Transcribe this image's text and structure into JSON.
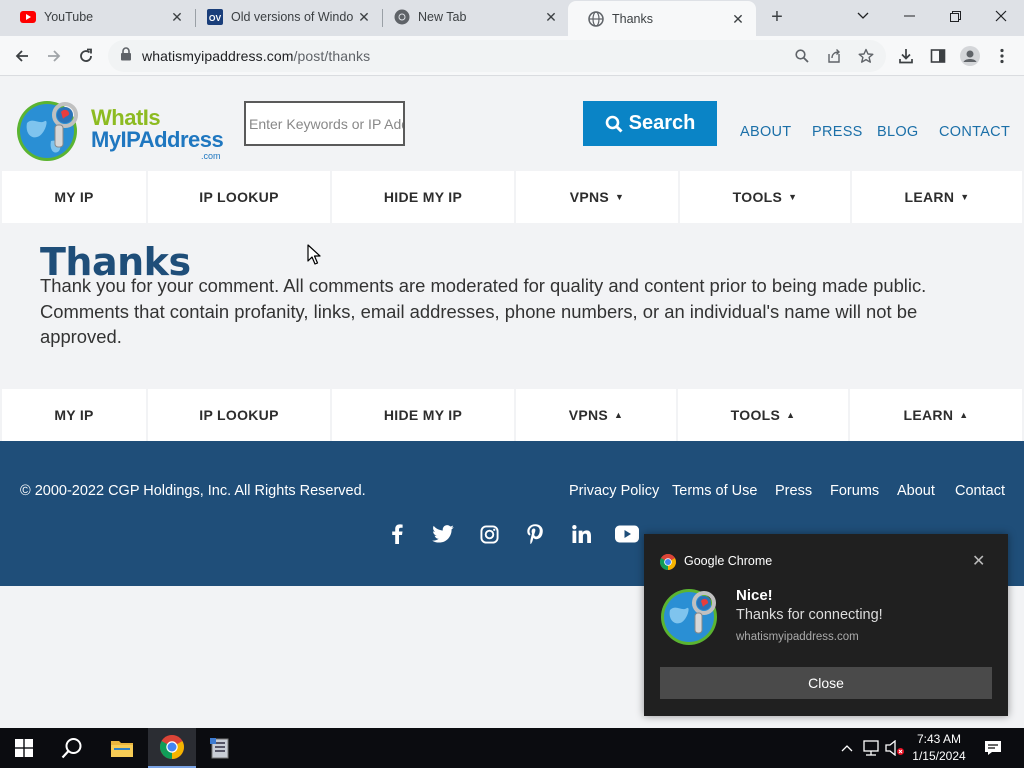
{
  "browser": {
    "tabs": [
      {
        "label": "YouTube",
        "icon": "youtube-icon",
        "active": false
      },
      {
        "label": "Old versions of Windo",
        "icon": "oldversion-icon",
        "active": false
      },
      {
        "label": "New Tab",
        "icon": "chrome-icon",
        "active": false
      },
      {
        "label": "Thanks",
        "icon": "globe-icon",
        "active": true
      }
    ],
    "url_host": "whatismyipaddress.com",
    "url_path": "/post/thanks"
  },
  "site": {
    "logo": {
      "line1": "WhatIs",
      "line2": "MyIPAddress",
      "line3": ".com"
    },
    "search_placeholder": "Enter Keywords or IP Address",
    "search_button": "Search",
    "top_nav": [
      "ABOUT",
      "PRESS",
      "BLOG",
      "CONTACT"
    ],
    "menu_top": [
      "MY IP",
      "IP LOOKUP",
      "HIDE MY IP",
      "VPNS",
      "TOOLS",
      "LEARN"
    ],
    "menu_top_carets": [
      "",
      "",
      "",
      "▼",
      "▼",
      "▼"
    ],
    "menu_bottom": [
      "MY IP",
      "IP LOOKUP",
      "HIDE MY IP",
      "VPNS",
      "TOOLS",
      "LEARN"
    ],
    "menu_bottom_carets": [
      "",
      "",
      "",
      "▲",
      "▲",
      "▲"
    ],
    "title": "Thanks",
    "body": "Thank you for your comment. All comments are moderated for quality and content prior to being made public. Comments that contain profanity, links, email addresses, phone numbers, or an individual's name will not be approved.",
    "footer": {
      "copyright": "© 2000-2022 CGP Holdings, Inc. All Rights Reserved.",
      "links": [
        "Privacy Policy",
        "Terms of Use",
        "Press",
        "Forums",
        "About",
        "Contact"
      ],
      "social": [
        "facebook-icon",
        "twitter-icon",
        "instagram-icon",
        "pinterest-icon",
        "linkedin-icon",
        "youtube-icon"
      ]
    }
  },
  "notification": {
    "app": "Google Chrome",
    "title": "Nice!",
    "body": "Thanks for connecting!",
    "source": "whatismyipaddress.com",
    "button": "Close"
  },
  "taskbar": {
    "time": "7:43 AM",
    "date": "1/15/2024"
  },
  "colors": {
    "brand_blue": "#1f4e79",
    "search_button": "#0a84c6",
    "link": "#1b6fa8",
    "logo_green": "#8dbb21",
    "logo_blue": "#1f77c0"
  }
}
